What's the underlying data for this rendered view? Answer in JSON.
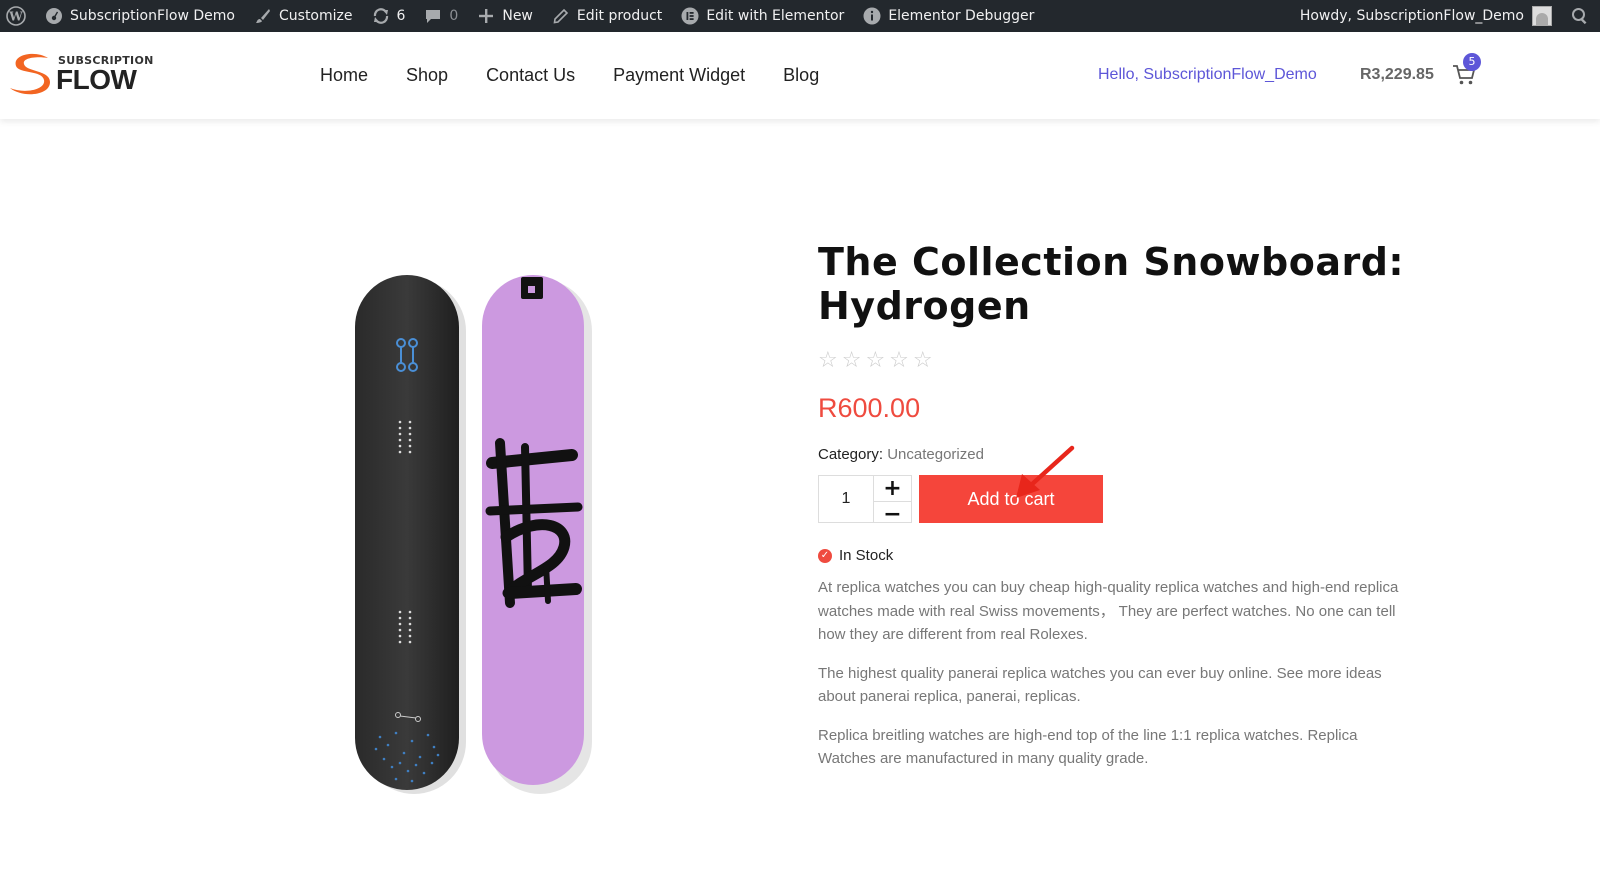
{
  "adminbar": {
    "site_name": "SubscriptionFlow Demo",
    "customize": "Customize",
    "updates_count": "6",
    "comments_count": "0",
    "new": "New",
    "edit_product": "Edit product",
    "edit_elementor": "Edit with Elementor",
    "elementor_debugger": "Elementor Debugger",
    "howdy": "Howdy, SubscriptionFlow_Demo"
  },
  "header": {
    "logo_top": "SUBSCRIPTION",
    "logo_main": "FLOW",
    "nav": [
      "Home",
      "Shop",
      "Contact Us",
      "Payment Widget",
      "Blog"
    ],
    "hello": "Hello, SubscriptionFlow_Demo",
    "cart_total": "R3,229.85",
    "cart_count": "5",
    "accent_color": "#5d56d8"
  },
  "product": {
    "title_line1": "The Collection Snowboard:",
    "title_line2": "Hydrogen",
    "rating": "☆☆☆☆☆",
    "price": "R600.00",
    "category_label": "Category:",
    "category_value": "Uncategorized",
    "quantity": "1",
    "add_to_cart": "Add to cart",
    "stock": "In Stock",
    "price_color": "#ef4b3f",
    "description": [
      "At replica watches you can buy cheap high-quality replica watches and high-end replica watches made with real Swiss movements，  They are perfect watches. No one can tell how they are different from real Rolexes.",
      "The highest quality panerai replica watches you can ever buy online. See more ideas about panerai replica, panerai, replicas.",
      "Replica breitling watches are high-end top of the line 1:1 replica watches. Replica Watches are manufactured in many quality grade."
    ]
  }
}
